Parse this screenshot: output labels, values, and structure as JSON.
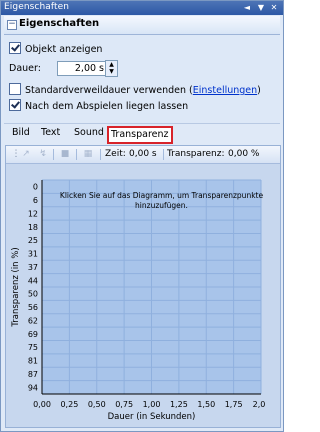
{
  "window": {
    "title": "Eigenschaften",
    "controls": [
      "◄",
      "▼",
      "✕"
    ]
  },
  "group": {
    "title": "Eigenschaften",
    "collapse_symbol": "−"
  },
  "options": {
    "show_object": {
      "label": "Objekt anzeigen",
      "checked": true
    },
    "duration_label": "Dauer:",
    "duration_value": "2,00 s",
    "std_duration": {
      "label_prefix": "Standardverweildauer verwenden (",
      "link": "Einstellungen",
      "label_suffix": ")",
      "checked": false
    },
    "keep_after": {
      "label": "Nach dem Abspielen liegen lassen",
      "checked": true
    }
  },
  "tabs": [
    {
      "label": "Bild",
      "active": false
    },
    {
      "label": "Text",
      "active": false
    },
    {
      "label": "Sound",
      "active": false
    },
    {
      "label": "Transparenz",
      "active": true
    }
  ],
  "toolbar": {
    "icons": [
      "pointer-icon",
      "curve-icon",
      "delete-icon",
      "grid-icon"
    ],
    "time_label": "Zeit:",
    "time_value": "0,00 s",
    "transparency_label": "Transparenz:",
    "transparency_value": "0,00 %"
  },
  "chart_data": {
    "type": "line",
    "title": "",
    "hint": [
      "Klicken Sie auf das Diagramm, um Transparenzpunkte",
      "hinzuzufügen."
    ],
    "xlabel": "Dauer (in Sekunden)",
    "ylabel": "Transparenz (in %)",
    "xlim": [
      0,
      2
    ],
    "ylim": [
      0,
      100
    ],
    "xticks": [
      "0,00",
      "0,25",
      "0,50",
      "0,75",
      "1,00",
      "1,25",
      "1,50",
      "1,75",
      "2,0"
    ],
    "yticks": [
      "0",
      "6",
      "12",
      "18",
      "25",
      "31",
      "37",
      "44",
      "50",
      "56",
      "62",
      "69",
      "75",
      "81",
      "87",
      "94"
    ],
    "series": [],
    "grid": true,
    "colors": {
      "background": "#a8c4ea",
      "grid": "#8fb0de",
      "axis": "#000000"
    }
  }
}
